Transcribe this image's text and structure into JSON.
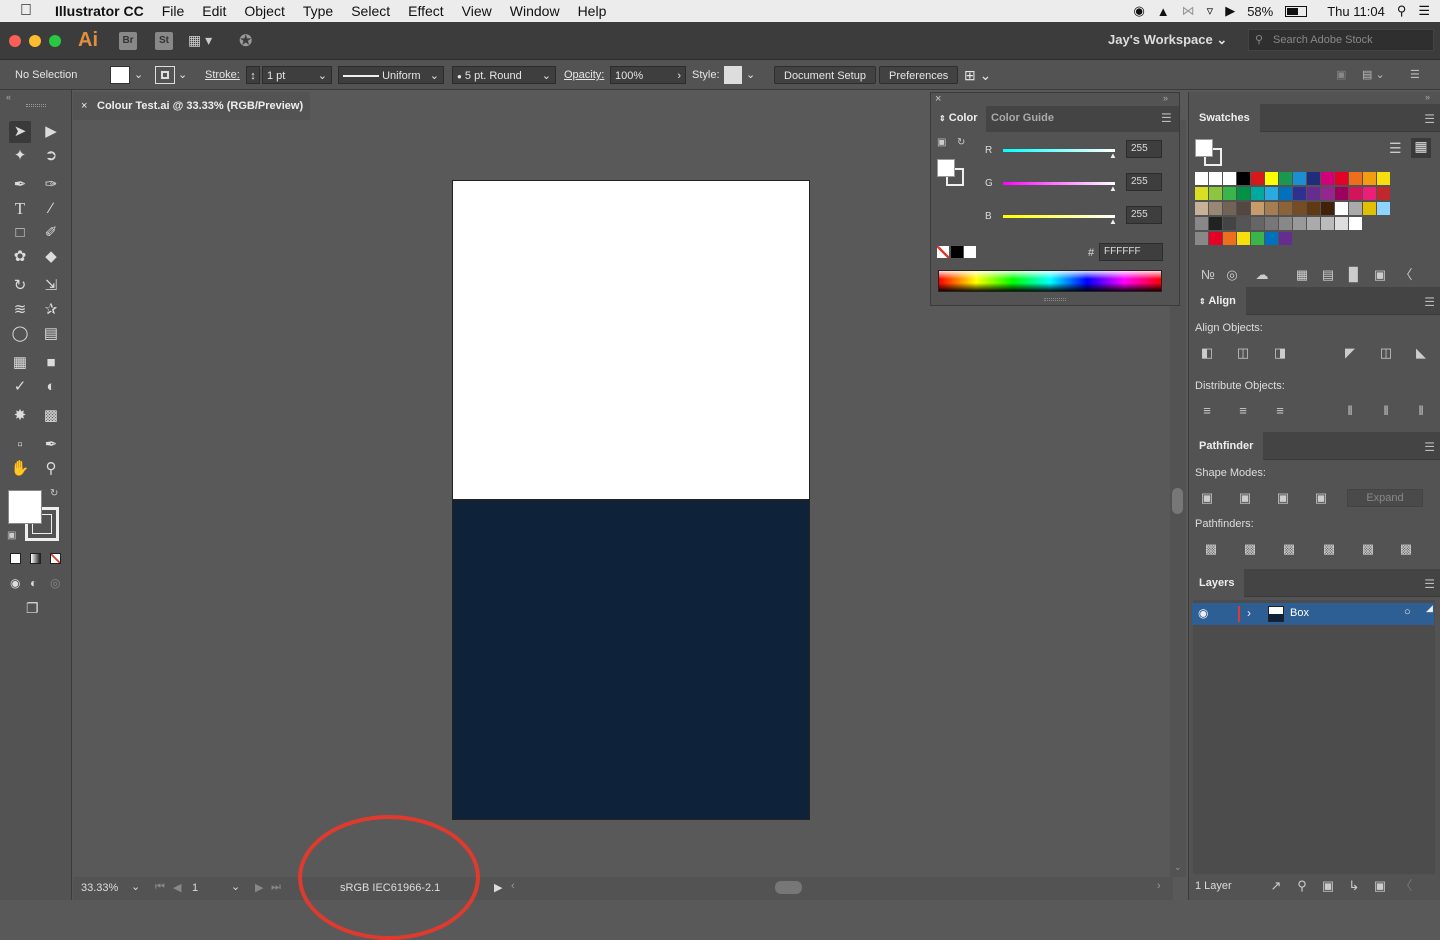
{
  "menubar": {
    "apple": "",
    "app_name": "Illustrator CC",
    "items": [
      "File",
      "Edit",
      "Object",
      "Type",
      "Select",
      "Effect",
      "View",
      "Window",
      "Help"
    ],
    "battery": "58%",
    "clock": "Thu 11:04"
  },
  "appbar": {
    "ai_label": "Ai",
    "br_label": "Br",
    "st_label": "St",
    "workspace": "Jay's Workspace",
    "stock_placeholder": "Search Adobe Stock"
  },
  "control": {
    "selection": "No Selection",
    "stroke_label": "Stroke:",
    "stroke_value": "1 pt",
    "profile": "Uniform",
    "brush": "5 pt. Round",
    "opacity_label": "Opacity:",
    "opacity_value": "100%",
    "style_label": "Style:",
    "document_setup": "Document Setup",
    "preferences": "Preferences"
  },
  "document": {
    "tab_title": "Colour Test.ai @ 33.33% (RGB/Preview)",
    "bottom_color": "#0e223a"
  },
  "status": {
    "zoom": "33.33%",
    "artboard": "1",
    "profile": "sRGB IEC61966-2.1"
  },
  "color_panel": {
    "tab_color": "Color",
    "tab_guide": "Color Guide",
    "r_label": "R",
    "g_label": "G",
    "b_label": "B",
    "r_value": "255",
    "g_value": "255",
    "b_value": "255",
    "hash": "#",
    "hex": "FFFFFF"
  },
  "swatches": {
    "title": "Swatches"
  },
  "align": {
    "title": "Align",
    "align_objects": "Align Objects:",
    "distribute_objects": "Distribute Objects:"
  },
  "pathfinder": {
    "title": "Pathfinder",
    "shape_modes": "Shape Modes:",
    "expand": "Expand",
    "pathfinders": "Pathfinders:"
  },
  "layers": {
    "title": "Layers",
    "layer_name": "Box",
    "count": "1 Layer"
  }
}
